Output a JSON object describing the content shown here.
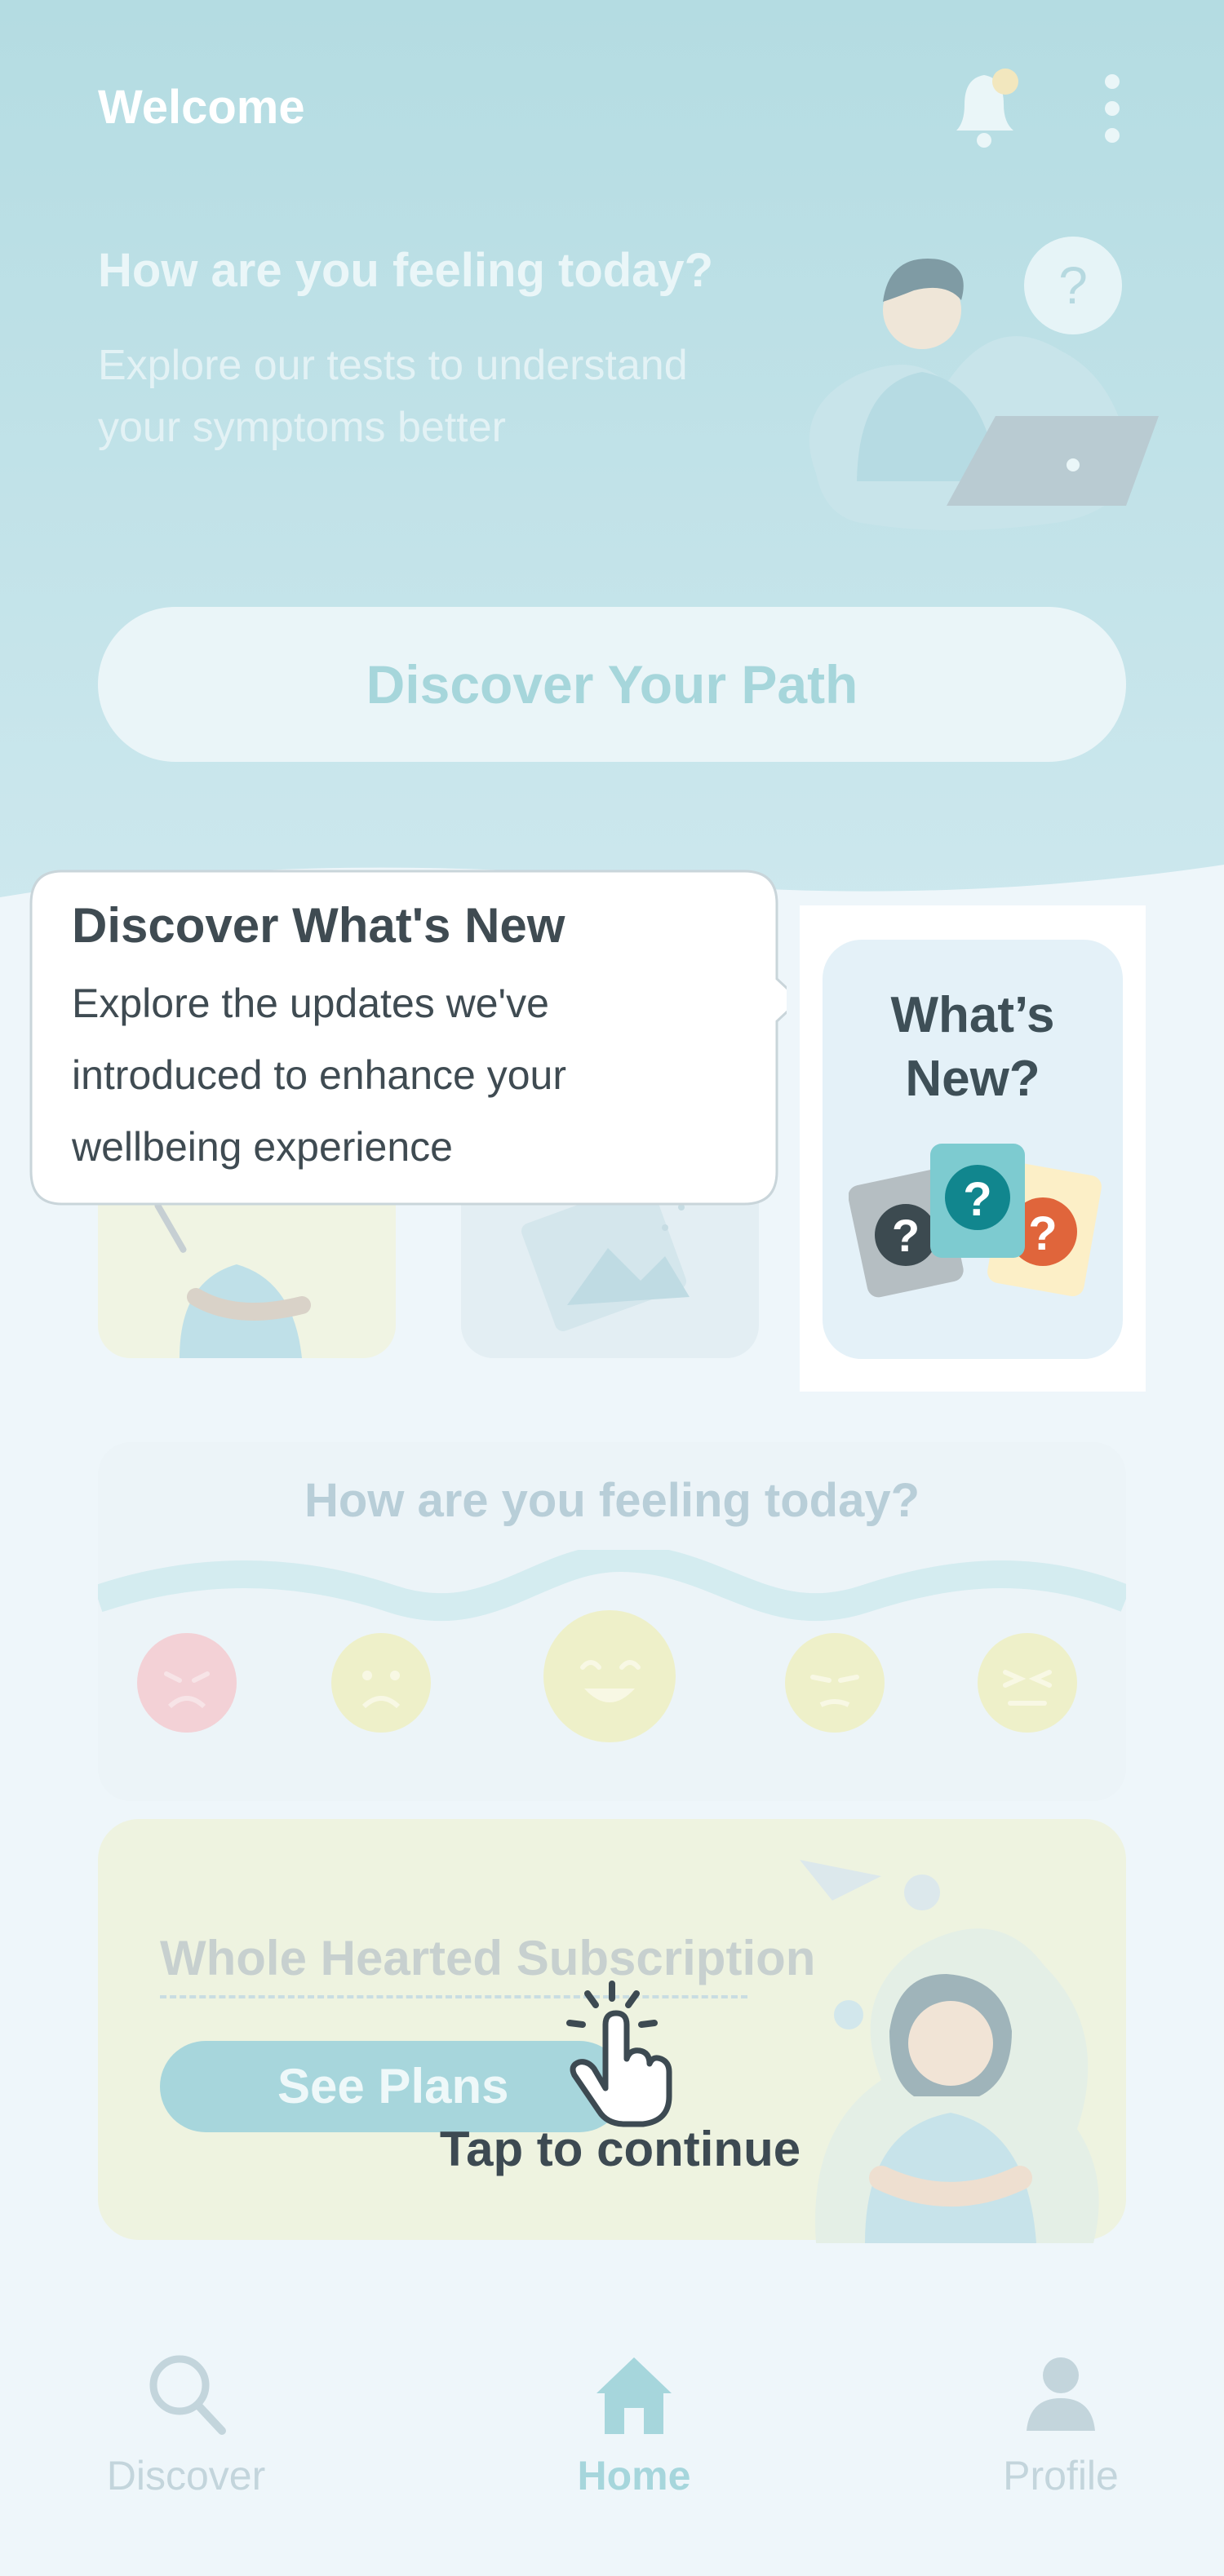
{
  "colors": {
    "header_bg": "#B4DCE2",
    "page_bg": "#EEF6FA",
    "text_dark": "#3F4B52",
    "accent": "#A7D6DC",
    "nav_active": "#A6D6DC",
    "nav_inactive": "#C3D5DC"
  },
  "header": {
    "title": "Welcome",
    "notification_icon": "bell-icon",
    "menu_icon": "more-vertical-icon"
  },
  "hero": {
    "heading": "How are you feeling today?",
    "subtitle": "Explore our tests to understand your symptoms better",
    "cta_label": "Discover Your Path"
  },
  "whats_new": {
    "title": "What’s New?"
  },
  "tooltip": {
    "title": "Discover What's New",
    "body": "Explore the updates we've introduced to enhance your wellbeing experience"
  },
  "mood": {
    "title": "How are you feeling today?",
    "emojis": [
      "angry-emoji-icon",
      "sad-emoji-icon",
      "happy-emoji-icon",
      "disappointed-emoji-icon",
      "tired-emoji-icon"
    ]
  },
  "subscription": {
    "title": "Whole Hearted Subscription",
    "button_label": "See Plans"
  },
  "coach": {
    "tap_label": "Tap to continue"
  },
  "nav": {
    "items": [
      {
        "label": "Discover",
        "icon": "search-icon",
        "active": false
      },
      {
        "label": "Home",
        "icon": "home-icon",
        "active": true
      },
      {
        "label": "Profile",
        "icon": "user-icon",
        "active": false
      }
    ]
  }
}
